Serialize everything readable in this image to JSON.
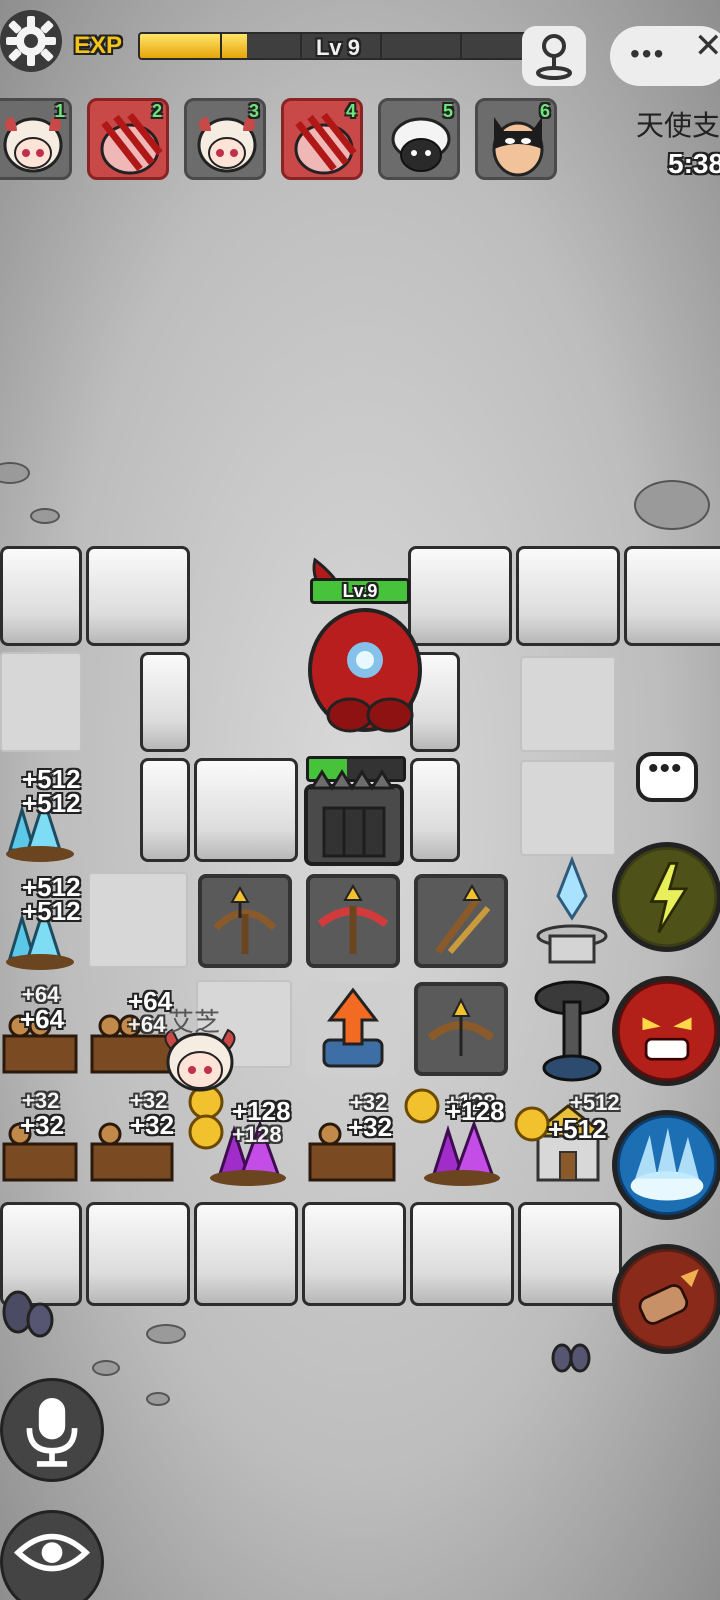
{
  "top_bar": {
    "exp_label": "EXP",
    "level": "Lv 9",
    "exp_progress": 0.27
  },
  "players": [
    {
      "num": "1",
      "avatar": "sheep-girl-icon",
      "highlight": false
    },
    {
      "num": "2",
      "avatar": "claw-slash-icon",
      "highlight": true
    },
    {
      "num": "3",
      "avatar": "sheep-girl-icon",
      "highlight": false
    },
    {
      "num": "4",
      "avatar": "claw-slash-icon",
      "highlight": true
    },
    {
      "num": "5",
      "avatar": "black-sheep-icon",
      "highlight": false
    },
    {
      "num": "6",
      "avatar": "masked-hero-icon",
      "highlight": false
    }
  ],
  "room": {
    "title": "天使支",
    "time": "5:38"
  },
  "boss": {
    "level": "Lv.9",
    "gate_hp": 0.4
  },
  "player_name": "艾芝",
  "resources": {
    "crystal_left_1": [
      "+512",
      "+512"
    ],
    "crystal_left_2": [
      "+512",
      "+512"
    ],
    "wood_left_1": [
      "+64",
      "+64"
    ],
    "wood_left_2": [
      "+64",
      "+64"
    ],
    "wood_bottom_1": [
      "+32",
      "+32"
    ],
    "wood_bottom_2": [
      "+32",
      "+32"
    ],
    "purple_1": [
      "+128",
      "+128"
    ],
    "wood_bottom_3": [
      "+32",
      "+32"
    ],
    "purple_2": [
      "+128",
      "+128"
    ],
    "house": [
      "+512",
      "+512"
    ]
  },
  "skills": [
    {
      "name": "lightning-dash-skill"
    },
    {
      "name": "rage-face-skill"
    },
    {
      "name": "ice-burst-skill"
    },
    {
      "name": "fist-strike-skill"
    }
  ],
  "colors": {
    "exp_fill": "#f3c317",
    "hp_green": "#46c33a",
    "highlight_red": "#c94848"
  }
}
